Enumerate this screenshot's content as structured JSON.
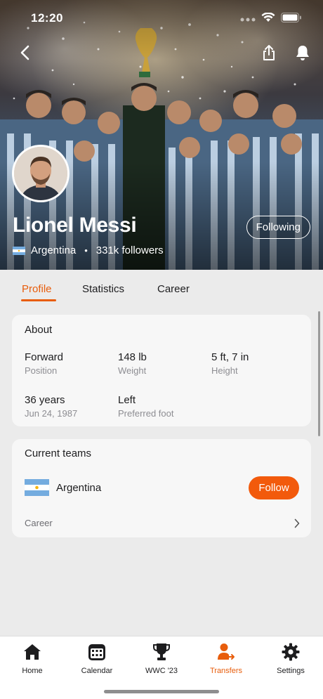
{
  "status_bar": {
    "time": "12:20"
  },
  "header": {
    "player_name": "Lionel Messi",
    "country": "Argentina",
    "separator": "•",
    "followers": "331k followers",
    "following_label": "Following",
    "icons": [
      "back-icon",
      "share-icon",
      "bell-icon"
    ]
  },
  "tabs": [
    {
      "label": "Profile",
      "active": true
    },
    {
      "label": "Statistics",
      "active": false
    },
    {
      "label": "Career",
      "active": false
    }
  ],
  "about": {
    "title": "About",
    "stats": [
      {
        "value": "Forward",
        "label": "Position"
      },
      {
        "value": "148 lb",
        "label": "Weight"
      },
      {
        "value": "5 ft, 7 in",
        "label": "Height"
      },
      {
        "value": "36 years",
        "label": "Jun 24, 1987"
      },
      {
        "value": "Left",
        "label": "Preferred foot"
      }
    ]
  },
  "current_teams": {
    "title": "Current teams",
    "team_name": "Argentina",
    "follow_label": "Follow",
    "career_label": "Career"
  },
  "bottom_nav": [
    {
      "label": "Home",
      "icon": "home-icon",
      "active": false
    },
    {
      "label": "Calendar",
      "icon": "calendar-icon",
      "active": false
    },
    {
      "label": "WWC '23",
      "icon": "trophy-icon",
      "active": false
    },
    {
      "label": "Transfers",
      "icon": "transfers-icon",
      "active": true
    },
    {
      "label": "Settings",
      "icon": "gear-icon",
      "active": false
    }
  ],
  "colors": {
    "accent": "#e85d0c",
    "follow_button": "#f25a0c",
    "background": "#ebebeb",
    "card": "#f7f7f7",
    "argentina_blue": "#74acdf"
  }
}
